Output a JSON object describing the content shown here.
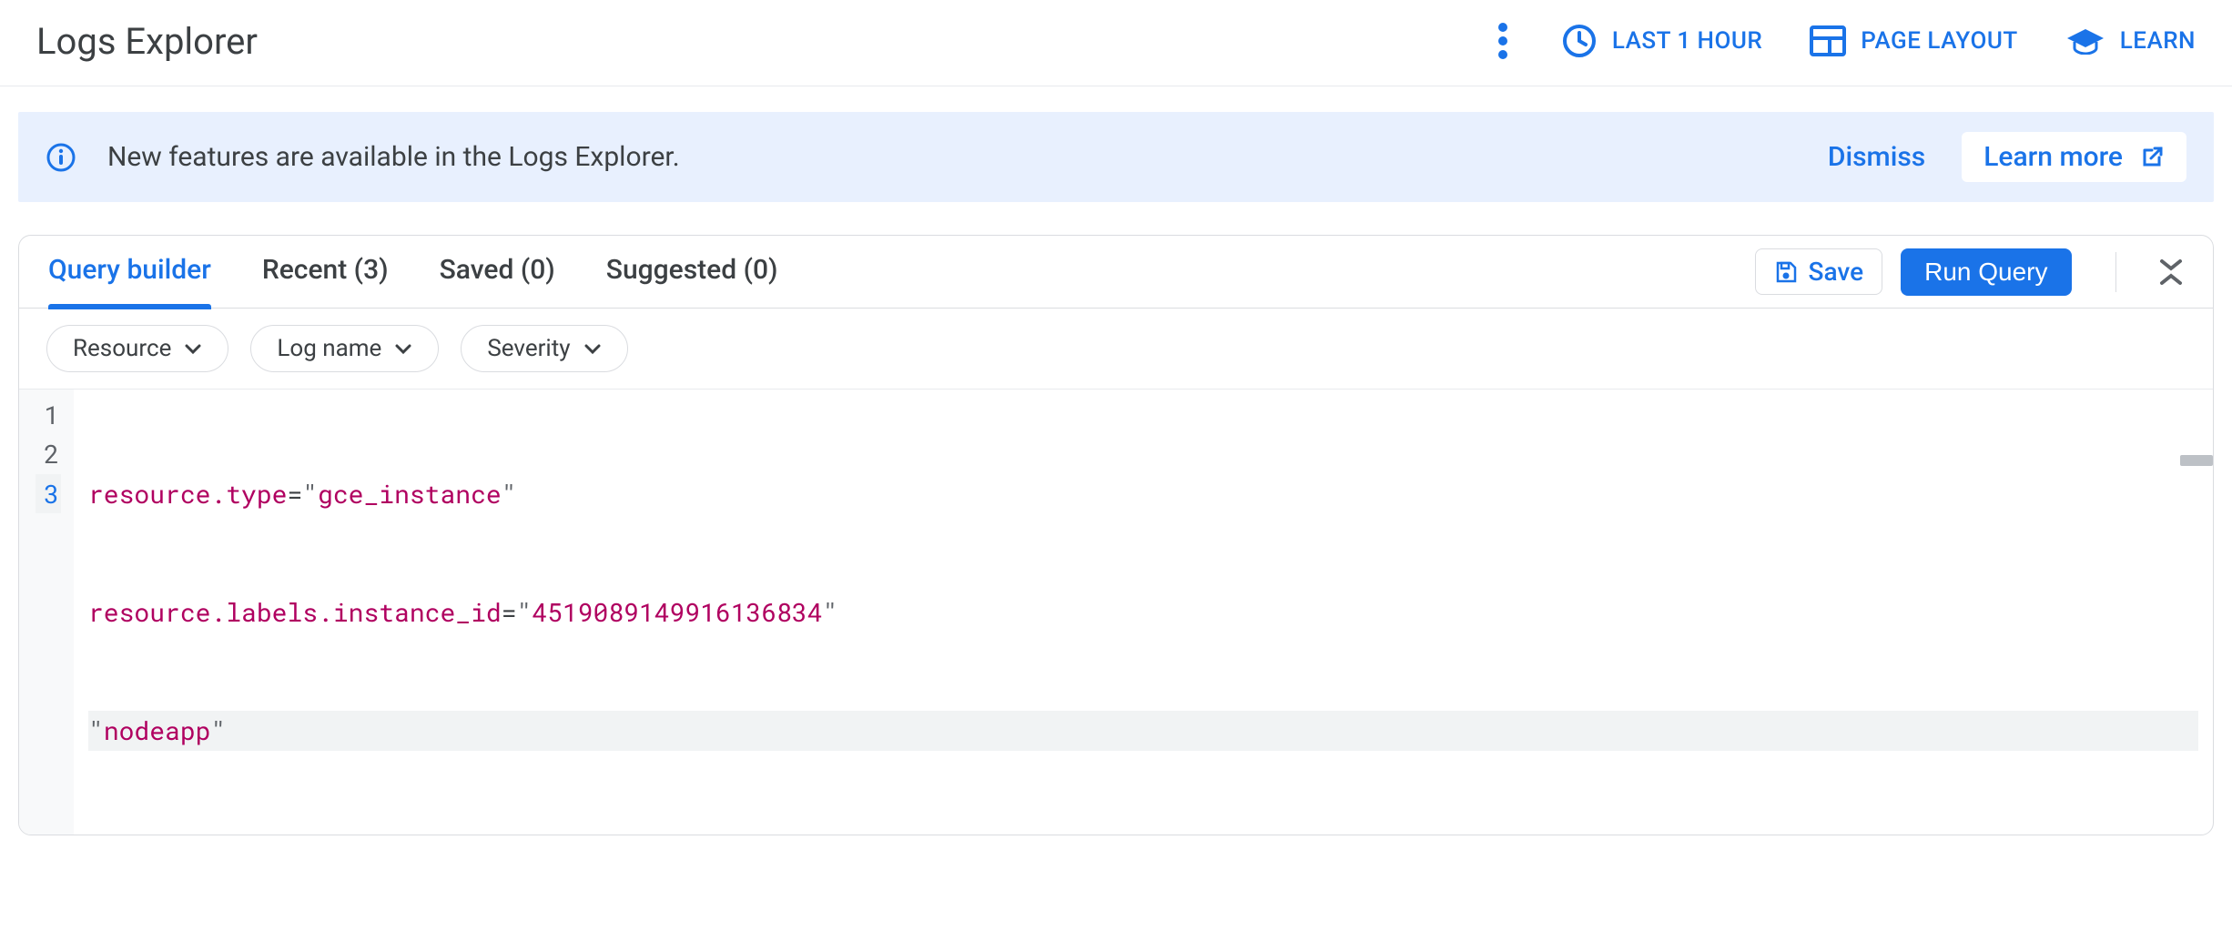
{
  "header": {
    "title": "Logs Explorer",
    "time_range": "LAST 1 HOUR",
    "page_layout": "PAGE LAYOUT",
    "learn": "LEARN"
  },
  "banner": {
    "text": "New features are available in the Logs Explorer.",
    "dismiss": "Dismiss",
    "learn_more": "Learn more"
  },
  "tabs": {
    "items": [
      {
        "label": "Query builder",
        "active": true
      },
      {
        "label": "Recent (3)",
        "active": false
      },
      {
        "label": "Saved (0)",
        "active": false
      },
      {
        "label": "Suggested (0)",
        "active": false
      }
    ],
    "save": "Save",
    "run": "Run Query"
  },
  "chips": {
    "resource": "Resource",
    "log_name": "Log name",
    "severity": "Severity"
  },
  "editor": {
    "lines": [
      {
        "n": "1",
        "ident": "resource.type",
        "eq": "=",
        "q1": "\"",
        "str": "gce_instance",
        "q2": "\""
      },
      {
        "n": "2",
        "ident": "resource.labels.instance_id",
        "eq": "=",
        "q1": "\"",
        "str": "4519089149916136834",
        "q2": "\""
      },
      {
        "n": "3",
        "q1": "\"",
        "str": "nodeapp",
        "q2": "\""
      }
    ]
  },
  "colors": {
    "primary": "#1a73e8"
  }
}
